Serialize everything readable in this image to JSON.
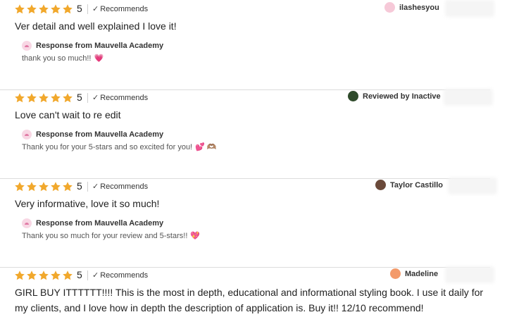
{
  "rating_value": "5",
  "recommends_label": "Recommends",
  "check_glyph": "✓",
  "star_color": "#f1a82c",
  "reviews": [
    {
      "reviewer": "ilashesyou",
      "reviewer_prefix": "",
      "avatar_color": "#f6c9d8",
      "text": "Ver detail and well explained I love it!",
      "response_from": "Response from Mauvella Academy",
      "response_text": "thank you so much!!",
      "response_emoji": "💗"
    },
    {
      "reviewer": "Reviewed by Inactive",
      "avatar_color": "#2e4a2a",
      "text": "Love can't wait to re edit",
      "response_from": "Response from Mauvella Academy",
      "response_text": "Thank you for your 5-stars and so excited for you!",
      "response_emoji": "💕 🫶🏽"
    },
    {
      "reviewer": "Taylor Castillo",
      "avatar_color": "#6b4a3a",
      "text": "Very informative, love it so much!",
      "response_from": "Response from Mauvella Academy",
      "response_text": "Thank you so much for your review and 5-stars!!",
      "response_emoji": "💖"
    },
    {
      "reviewer": "Madeline",
      "avatar_color": "#f39a6a",
      "text": "GIRL BUY ITTTTTT!!!! This is the most in depth, educational and informational styling book. I use it daily for my clients, and I love how in depth the description of application is. Buy it!! 12/10 recommend!"
    }
  ]
}
